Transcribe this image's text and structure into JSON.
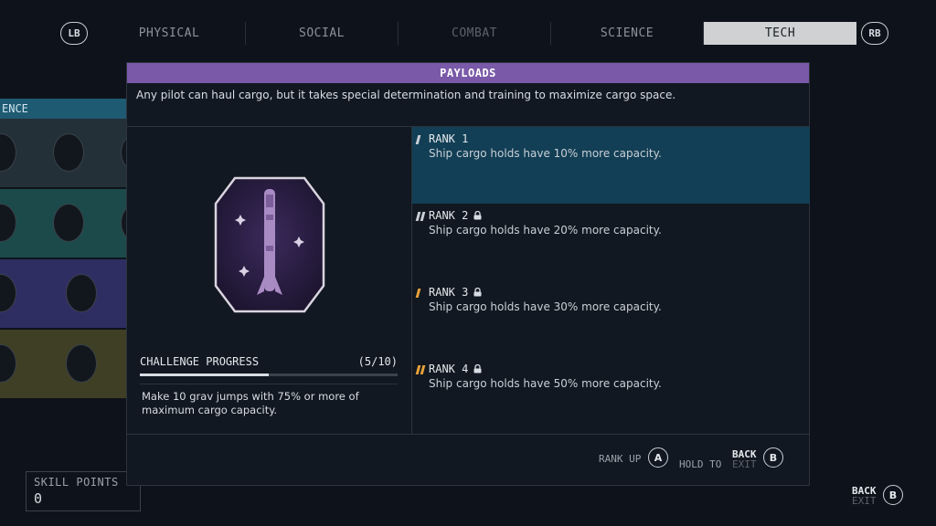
{
  "nav": {
    "left_button": "LB",
    "right_button": "RB",
    "tabs": [
      {
        "label": "PHYSICAL"
      },
      {
        "label": "SOCIAL"
      },
      {
        "label": "COMBAT"
      },
      {
        "label": "SCIENCE"
      },
      {
        "label": "TECH",
        "active": true
      }
    ]
  },
  "background_panel": {
    "header_label": "ENCE"
  },
  "modal": {
    "title": "PAYLOADS",
    "description": "Any pilot can haul cargo, but it takes special determination and training to maximize cargo space.",
    "badge_icon": "rocket-badge-icon",
    "challenge": {
      "label": "CHALLENGE PROGRESS",
      "progress_text": "(5/10)",
      "progress": 0.5,
      "description": "Make 10 grav jumps with 75% or more of maximum cargo capacity."
    },
    "ranks": [
      {
        "title": "RANK 1",
        "desc": "Ship cargo holds have 10% more capacity.",
        "locked": false,
        "active": true
      },
      {
        "title": "RANK 2",
        "desc": "Ship cargo holds have 20% more capacity.",
        "locked": true,
        "active": false
      },
      {
        "title": "RANK 3",
        "desc": "Ship cargo holds have 30% more capacity.",
        "locked": true,
        "active": false
      },
      {
        "title": "RANK 4",
        "desc": "Ship cargo holds have 50% more capacity.",
        "locked": true,
        "active": false
      }
    ],
    "footer": {
      "rank_up_label": "RANK UP",
      "rank_up_button": "A",
      "hold_to_label": "HOLD TO",
      "back_label": "BACK",
      "exit_label": "EXIT",
      "back_button": "B"
    }
  },
  "skill_points": {
    "label": "SKILL POINTS",
    "value": "0"
  },
  "corner": {
    "back_label": "BACK",
    "exit_label": "EXIT",
    "button": "B"
  },
  "colors": {
    "title_bar": "#7a5aa8",
    "active_rank": "#123f55",
    "rank_mark_gray": "#c9cfd6",
    "rank_mark_orange": "#e8a23a"
  }
}
